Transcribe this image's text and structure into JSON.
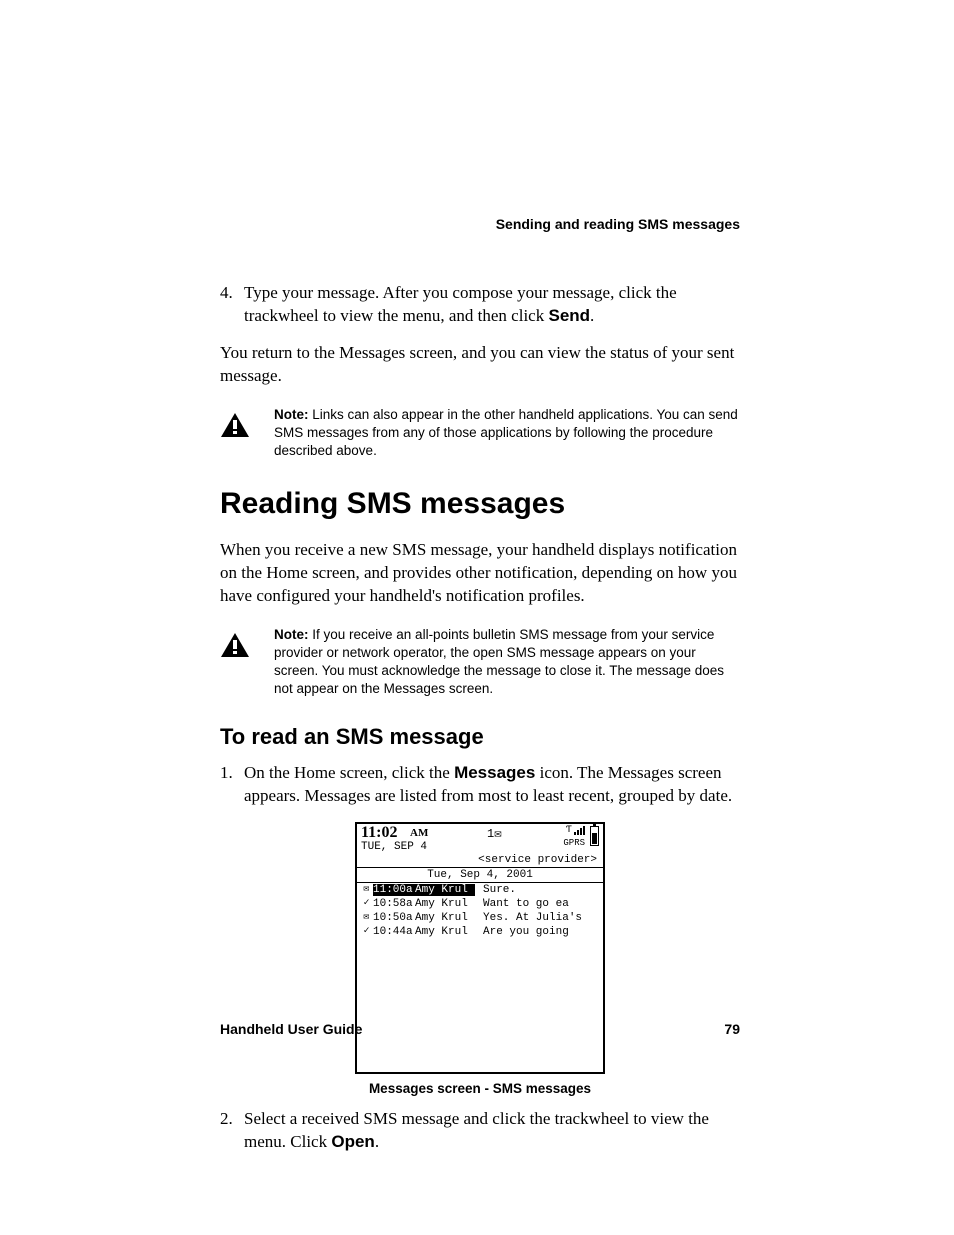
{
  "running_head": "Sending and reading SMS messages",
  "step4": {
    "num": "4.",
    "text_a": "Type your message. After you compose your message, click the trackwheel to view the menu, and then click ",
    "send": "Send",
    "text_b": "."
  },
  "return_p": "You return to the Messages screen, and you can view the status of your sent message.",
  "note1": {
    "label": "Note:",
    "text": " Links can also appear in the other handheld applications. You can send SMS messages from any of those applications by following the procedure described above."
  },
  "h1": "Reading SMS messages",
  "intro": "When you receive a new SMS message, your handheld displays notification on the Home screen, and provides other notification, depending on how you have configured your handheld's notification profiles.",
  "note2": {
    "label": "Note:",
    "text": " If you receive an all-points bulletin SMS message from your service provider or network operator, the open SMS message appears on your screen. You must acknowledge the message to close it. The message does not appear on the Messages screen."
  },
  "h2": "To read an SMS message",
  "step1": {
    "num": "1.",
    "text_a": "On the Home screen, click the ",
    "messages": "Messages",
    "text_b": " icon. The Messages screen appears. Messages are listed from most to least recent, grouped by date."
  },
  "shot": {
    "clock": "11:02",
    "ampm": "AM",
    "date": "TUE, SEP 4",
    "unread": "1",
    "gprs": "GPRS",
    "provider": "<service provider>",
    "date_header": "Tue, Sep 4, 2001",
    "rows": [
      {
        "icon": "✉",
        "time": "11:00a",
        "who": "Amy Krul",
        "prev": "Sure.",
        "sel": true
      },
      {
        "icon": "✓",
        "time": "10:58a",
        "who": "Amy Krul",
        "prev": "Want to go ea",
        "sel": false
      },
      {
        "icon": "✉",
        "time": "10:50a",
        "who": "Amy Krul",
        "prev": "Yes. At Julia's",
        "sel": false
      },
      {
        "icon": "✓",
        "time": "10:44a",
        "who": "Amy Krul",
        "prev": "Are you going",
        "sel": false
      }
    ]
  },
  "caption": "Messages screen - SMS messages",
  "step2": {
    "num": "2.",
    "text_a": "Select a received SMS message and click the trackwheel to view the menu. Click ",
    "open": "Open",
    "text_b": "."
  },
  "footer_left": "Handheld User Guide",
  "footer_right": "79"
}
